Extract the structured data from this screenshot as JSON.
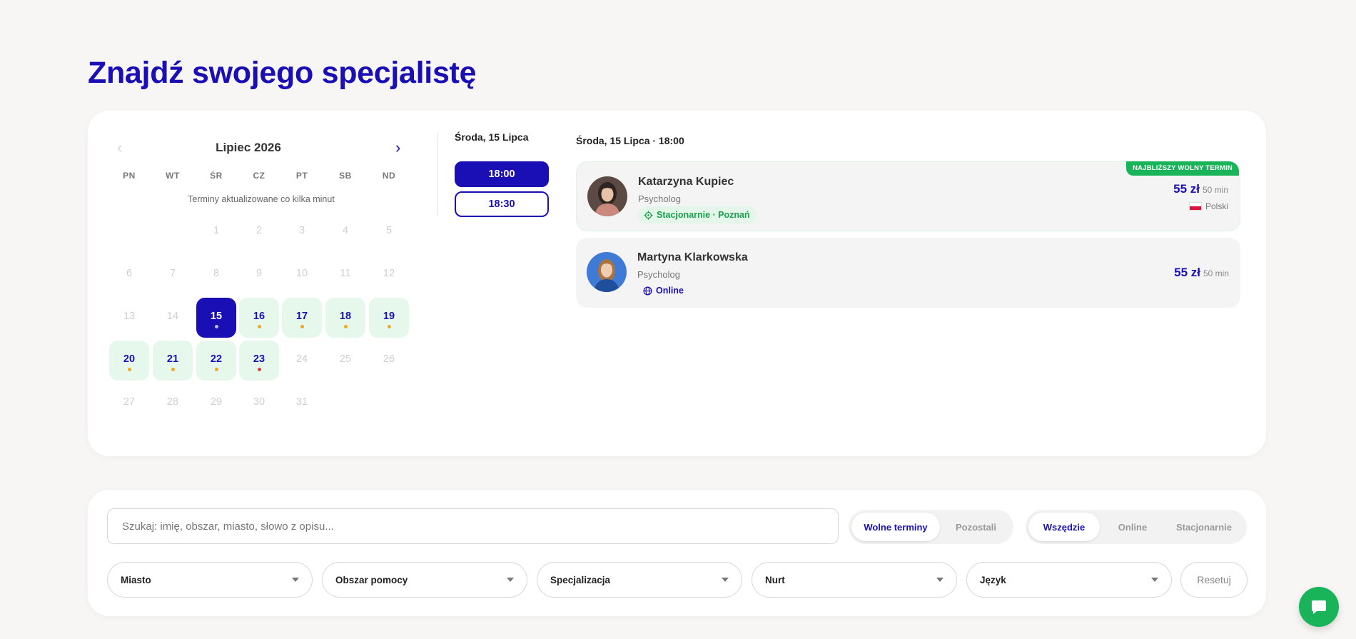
{
  "page": {
    "title": "Znajdź swojego specjalistę"
  },
  "calendar": {
    "month_label": "Lipiec 2026",
    "prev_icon": "‹",
    "next_icon": "›",
    "weekdays": [
      "PN",
      "WT",
      "ŚR",
      "CZ",
      "PT",
      "SB",
      "ND"
    ],
    "note": "Terminy aktualizowane co kilka minut",
    "days": [
      {
        "n": "1",
        "state": "disabled"
      },
      {
        "n": "2",
        "state": "disabled"
      },
      {
        "n": "3",
        "state": "disabled"
      },
      {
        "n": "4",
        "state": "disabled"
      },
      {
        "n": "5",
        "state": "disabled"
      },
      {
        "n": "6",
        "state": "disabled"
      },
      {
        "n": "7",
        "state": "disabled"
      },
      {
        "n": "8",
        "state": "disabled"
      },
      {
        "n": "9",
        "state": "disabled"
      },
      {
        "n": "10",
        "state": "disabled"
      },
      {
        "n": "11",
        "state": "disabled"
      },
      {
        "n": "12",
        "state": "disabled"
      },
      {
        "n": "13",
        "state": "disabled"
      },
      {
        "n": "14",
        "state": "disabled"
      },
      {
        "n": "15",
        "state": "selected",
        "dot": "white"
      },
      {
        "n": "16",
        "state": "available",
        "dot": "orange"
      },
      {
        "n": "17",
        "state": "available",
        "dot": "orange"
      },
      {
        "n": "18",
        "state": "available",
        "dot": "orange"
      },
      {
        "n": "19",
        "state": "available",
        "dot": "orange"
      },
      {
        "n": "20",
        "state": "available",
        "dot": "orange"
      },
      {
        "n": "21",
        "state": "available",
        "dot": "orange"
      },
      {
        "n": "22",
        "state": "available",
        "dot": "orange"
      },
      {
        "n": "23",
        "state": "available",
        "dot": "red"
      },
      {
        "n": "24",
        "state": "disabled"
      },
      {
        "n": "25",
        "state": "disabled"
      },
      {
        "n": "26",
        "state": "disabled"
      },
      {
        "n": "27",
        "state": "disabled"
      },
      {
        "n": "28",
        "state": "disabled"
      },
      {
        "n": "29",
        "state": "disabled"
      },
      {
        "n": "30",
        "state": "disabled"
      },
      {
        "n": "31",
        "state": "disabled"
      }
    ]
  },
  "slots": {
    "date_label": "Środa, 15 Lipca",
    "times": [
      "18:00",
      "18:30"
    ],
    "active": "18:00"
  },
  "specialists": {
    "heading": "Środa, 15 Lipca · 18:00",
    "items": [
      {
        "name": "Katarzyna Kupiec",
        "role": "Psycholog",
        "mode": "Stacjonarnie · Poznań",
        "mode_icon": "location-crosshair-icon",
        "price": "55 zł",
        "duration": "50 min",
        "language": "Polski",
        "badge": "NAJBLIŻSZY WOLNY TERMIN"
      },
      {
        "name": "Martyna Klarkowska",
        "role": "Psycholog",
        "mode": "Online",
        "mode_icon": "globe-icon",
        "price": "55 zł",
        "duration": "50 min"
      }
    ]
  },
  "filters": {
    "search_placeholder": "Szukaj: imię, obszar, miasto, słowo z opisu...",
    "availability": [
      "Wolne terminy",
      "Pozostali"
    ],
    "availability_active": "Wolne terminy",
    "location": [
      "Wszędzie",
      "Online",
      "Stacjonarnie"
    ],
    "location_active": "Wszędzie",
    "selects": [
      "Miasto",
      "Obszar pomocy",
      "Specjalizacja",
      "Nurt",
      "Język"
    ],
    "reset_label": "Resetuj"
  },
  "colors": {
    "accent": "#1a0fb5",
    "green": "#19b35a",
    "available_bg": "#e6f7ec"
  }
}
